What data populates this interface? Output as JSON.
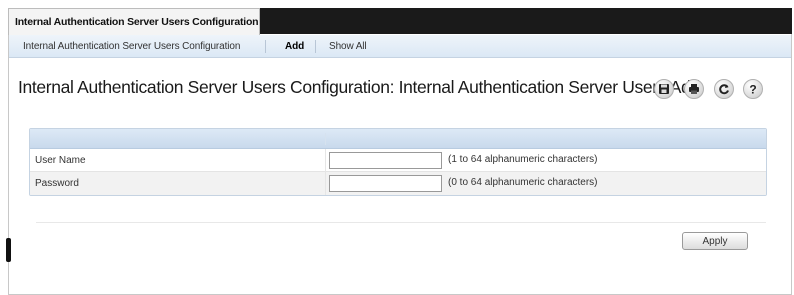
{
  "top_tab": {
    "label": "Internal Authentication Server Users Configuration"
  },
  "subnav": {
    "items": [
      {
        "label": "Internal Authentication Server Users Configuration",
        "active": false
      },
      {
        "label": "Add",
        "active": true
      },
      {
        "label": "Show All",
        "active": false
      }
    ]
  },
  "page_title": "Internal Authentication Server Users Configuration: Internal Authentication Server Users Add",
  "toolbar": {
    "icons": [
      "save-icon",
      "print-icon",
      "refresh-icon",
      "help-icon"
    ]
  },
  "form": {
    "rows": [
      {
        "label": "User Name",
        "value": "",
        "hint": "(1 to 64 alphanumeric characters)"
      },
      {
        "label": "Password",
        "value": "",
        "hint": "(0 to 64 alphanumeric characters)"
      }
    ]
  },
  "apply_label": "Apply"
}
